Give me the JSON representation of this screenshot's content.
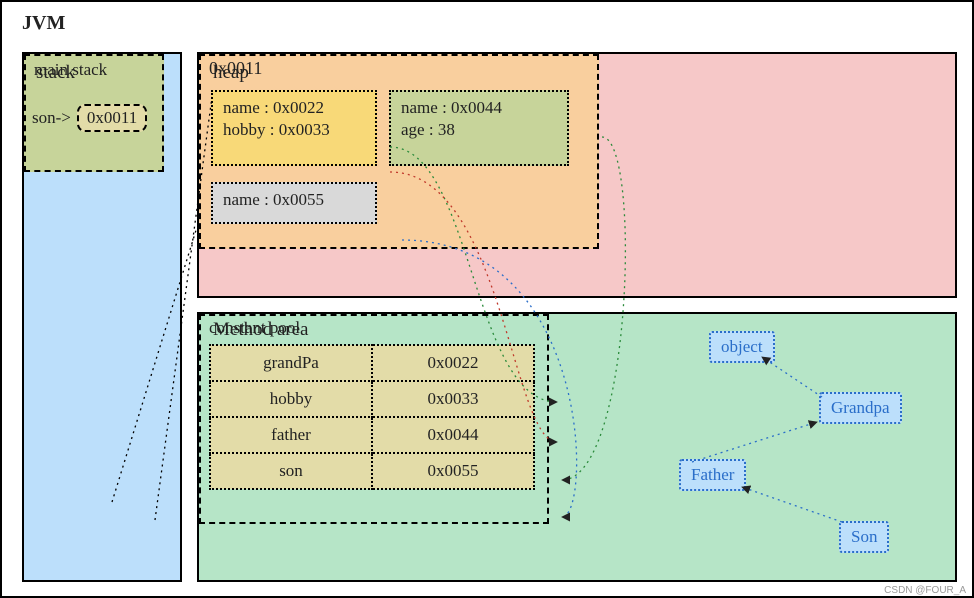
{
  "title": "JVM",
  "stack": {
    "title": "stack",
    "mainstack_label": "main stack",
    "var_name": "son->",
    "var_value": "0x0011"
  },
  "heap": {
    "title": "heap",
    "object": {
      "address": "0x0011",
      "son": {
        "name": "name : 0x0022",
        "hobby": "hobby : 0x0033"
      },
      "father": {
        "name": "name : 0x0044",
        "age": "age : 38"
      },
      "grandpa": {
        "name": "name : 0x0055"
      }
    }
  },
  "method_area": {
    "title": "Method area",
    "pool_title": "constant pool",
    "rows": [
      {
        "k": "grandPa",
        "v": "0x0022"
      },
      {
        "k": "hobby",
        "v": "0x0033"
      },
      {
        "k": "father",
        "v": "0x0044"
      },
      {
        "k": "son",
        "v": "0x0055"
      }
    ],
    "hierarchy": {
      "object": "object",
      "grandpa": "Grandpa",
      "father": "Father",
      "son": "Son"
    }
  },
  "watermark": "CSDN @FOUR_A"
}
